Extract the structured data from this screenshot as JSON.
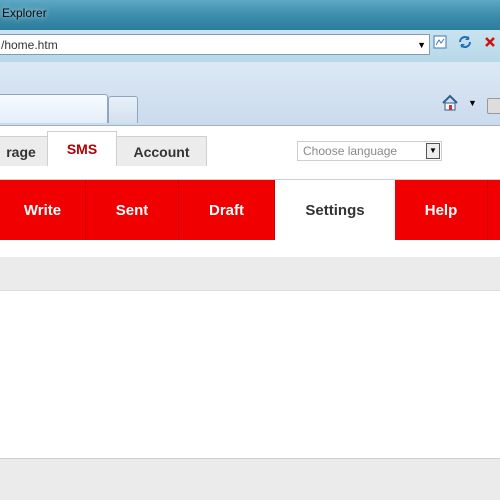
{
  "window": {
    "title": "Explorer"
  },
  "address_bar": {
    "url": "/home.htm"
  },
  "toolbar_icons": [
    "compatibility-icon",
    "refresh-icon",
    "stop-icon"
  ],
  "browser_tabs": {
    "home_icon": "home-icon",
    "feeds_icon": "rss-icon"
  },
  "app_tabs": [
    {
      "label": "rage",
      "active": false
    },
    {
      "label": "SMS",
      "active": true
    },
    {
      "label": "Account",
      "active": false
    }
  ],
  "language_select": {
    "placeholder": "Choose language"
  },
  "sms_nav": [
    {
      "label": "Write",
      "active": false
    },
    {
      "label": "Sent",
      "active": false
    },
    {
      "label": "Draft",
      "active": false
    },
    {
      "label": "Settings",
      "active": true
    },
    {
      "label": "Help",
      "active": false
    }
  ],
  "colors": {
    "nav_red": "#f00000",
    "active_tab_text": "#b00000"
  }
}
